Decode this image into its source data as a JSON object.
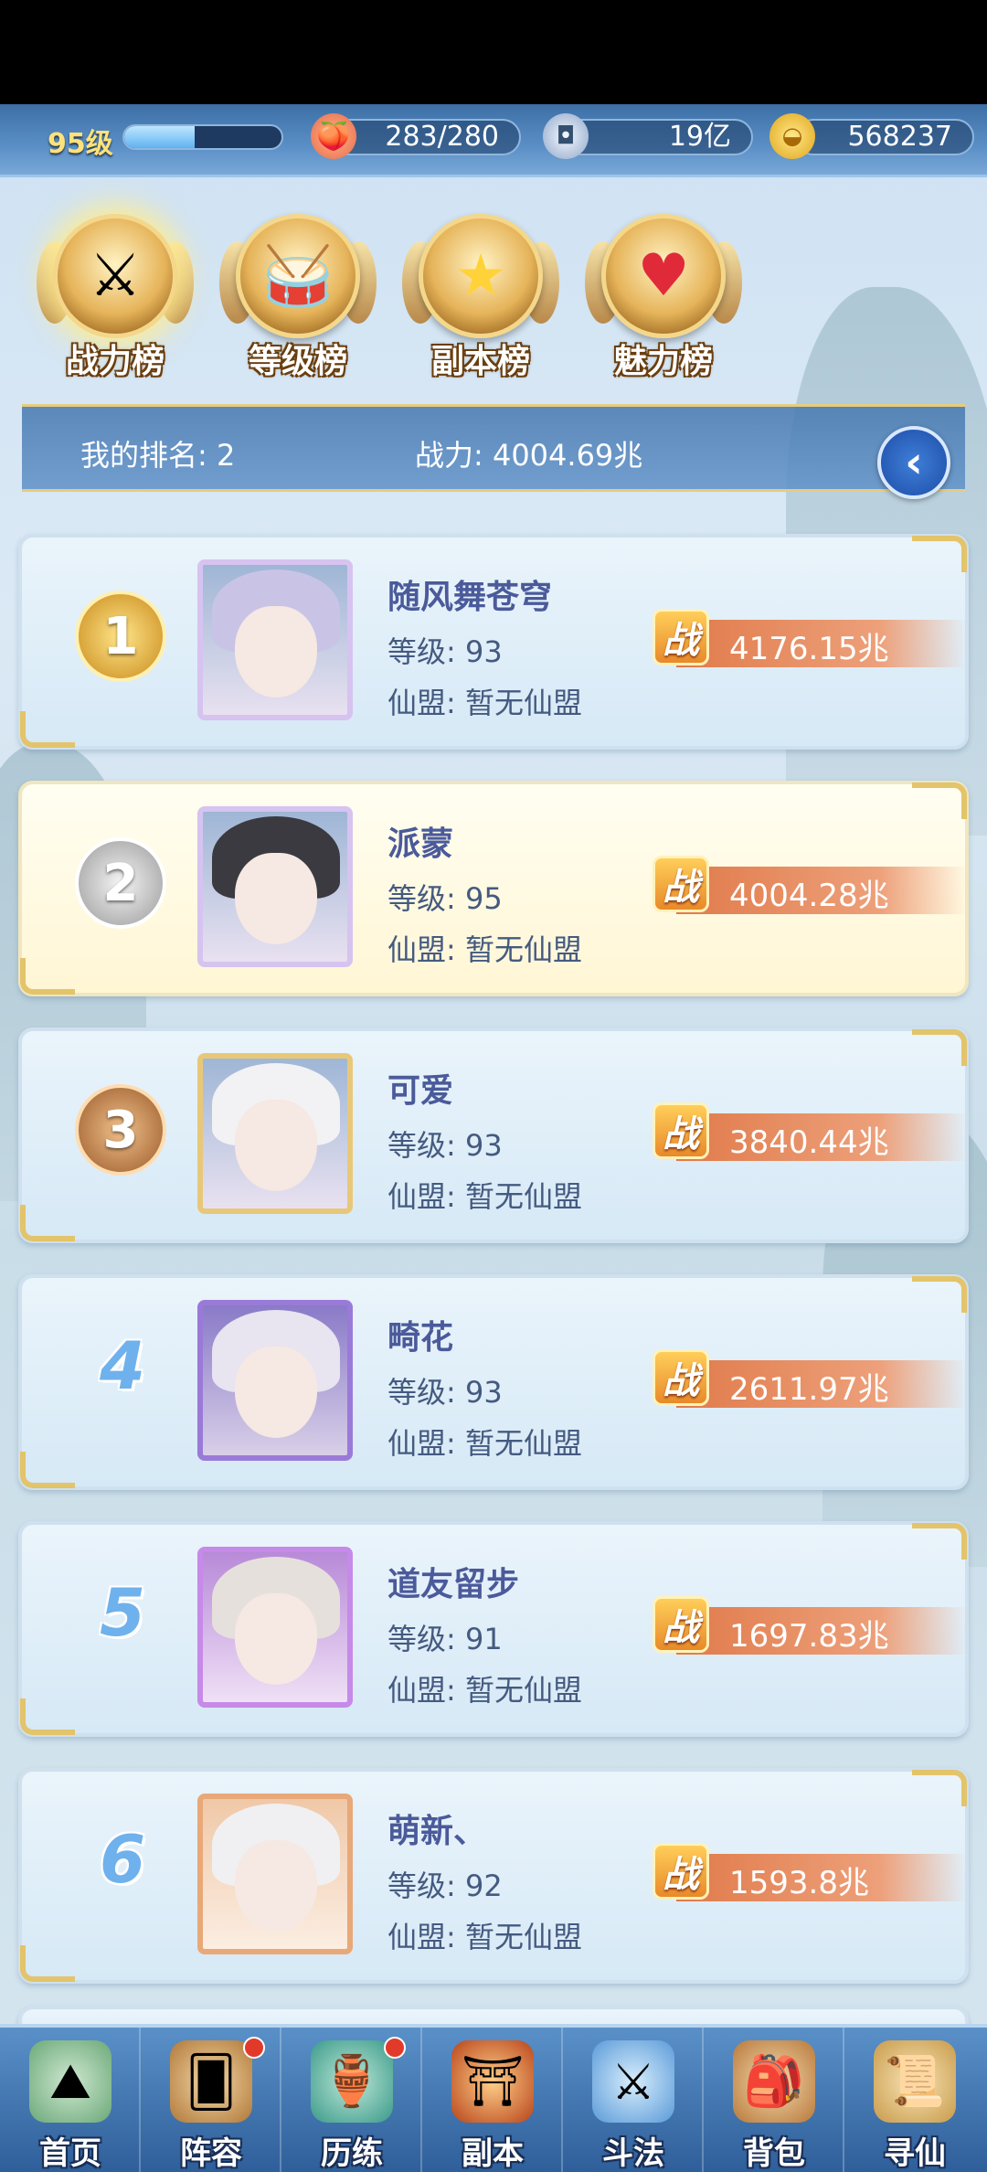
{
  "topbar": {
    "level": "95级",
    "exp_progress": 0.45,
    "stamina": "283/280",
    "silver": "19亿",
    "gold": "568237"
  },
  "tabs": [
    {
      "label": "战力榜",
      "icon": "sword-medal-icon",
      "active": true
    },
    {
      "label": "等级榜",
      "icon": "drum-medal-icon",
      "active": false
    },
    {
      "label": "副本榜",
      "icon": "star-medal-icon",
      "active": false
    },
    {
      "label": "魅力榜",
      "icon": "heart-medal-icon",
      "active": false
    }
  ],
  "my_rank": {
    "rank_text": "我的排名: 2",
    "power_text": "战力: 4004.69兆"
  },
  "power_icon_char": "战",
  "entries": [
    {
      "rank": "1",
      "name": "随风舞苍穹",
      "level": "等级: 93",
      "guild": "仙盟: 暂无仙盟",
      "power": "4176.15兆"
    },
    {
      "rank": "2",
      "name": "派蒙",
      "level": "等级: 95",
      "guild": "仙盟: 暂无仙盟",
      "power": "4004.28兆"
    },
    {
      "rank": "3",
      "name": "可爱",
      "level": "等级: 93",
      "guild": "仙盟: 暂无仙盟",
      "power": "3840.44兆"
    },
    {
      "rank": "4",
      "name": "畸花",
      "level": "等级: 93",
      "guild": "仙盟: 暂无仙盟",
      "power": "2611.97兆"
    },
    {
      "rank": "5",
      "name": "道友留步",
      "level": "等级: 91",
      "guild": "仙盟: 暂无仙盟",
      "power": "1697.83兆"
    },
    {
      "rank": "6",
      "name": "萌新、",
      "level": "等级: 92",
      "guild": "仙盟: 暂无仙盟",
      "power": "1593.8兆"
    }
  ],
  "bottom_nav": [
    {
      "label": "首页",
      "icon": "home-island-icon"
    },
    {
      "label": "阵容",
      "icon": "lineup-cards-icon"
    },
    {
      "label": "历练",
      "icon": "training-gourd-icon"
    },
    {
      "label": "副本",
      "icon": "dungeon-gate-icon"
    },
    {
      "label": "斗法",
      "icon": "battle-sword-icon"
    },
    {
      "label": "背包",
      "icon": "backpack-icon"
    },
    {
      "label": "寻仙",
      "icon": "scroll-icon"
    }
  ]
}
